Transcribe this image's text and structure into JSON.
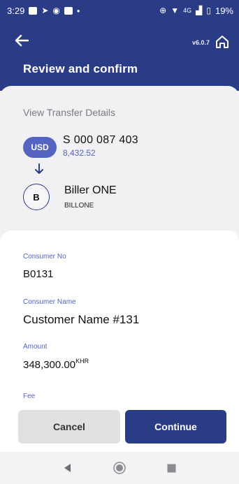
{
  "status_bar": {
    "time": "3:29",
    "left_dot": "•",
    "network": "4G",
    "battery": "19%"
  },
  "header": {
    "version": "v6.0.7",
    "title": "Review and confirm"
  },
  "transfer": {
    "section_label": "View Transfer Details",
    "from": {
      "currency": "USD",
      "account_no": "S 000 087 403",
      "balance": "8,432.52"
    },
    "to": {
      "initial": "B",
      "name": "Biller ONE",
      "code": "BILLONE"
    }
  },
  "details": {
    "consumer_no_label": "Consumer No",
    "consumer_no": "B0131",
    "consumer_name_label": "Consumer Name",
    "consumer_name": "Customer Name #131",
    "amount_label": "Amount",
    "amount": "348,300.00",
    "amount_currency": "KHR",
    "fee_label": "Fee"
  },
  "actions": {
    "cancel": "Cancel",
    "continue": "Continue"
  },
  "colors": {
    "primary": "#2b3c87",
    "accent": "#5563c1"
  }
}
